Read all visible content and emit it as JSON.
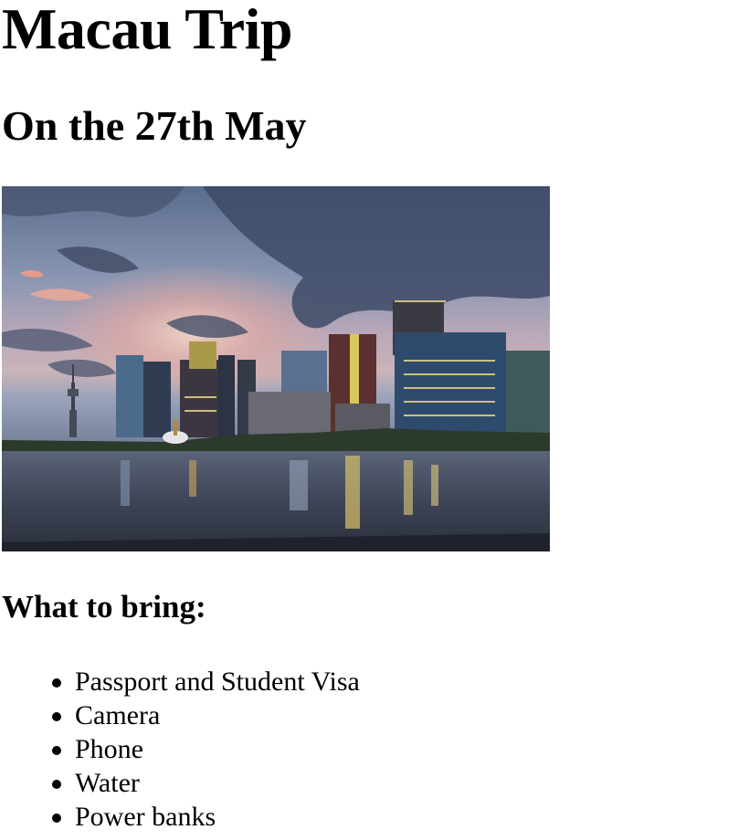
{
  "page": {
    "title": "Macau Trip",
    "date_heading": "On the 27th May",
    "image": {
      "subject": "Macau city skyline at dusk reflected in the water"
    },
    "bring_heading": "What to bring:",
    "bring_items": [
      "Passport and Student Visa",
      "Camera",
      "Phone",
      "Water",
      "Power banks"
    ]
  }
}
